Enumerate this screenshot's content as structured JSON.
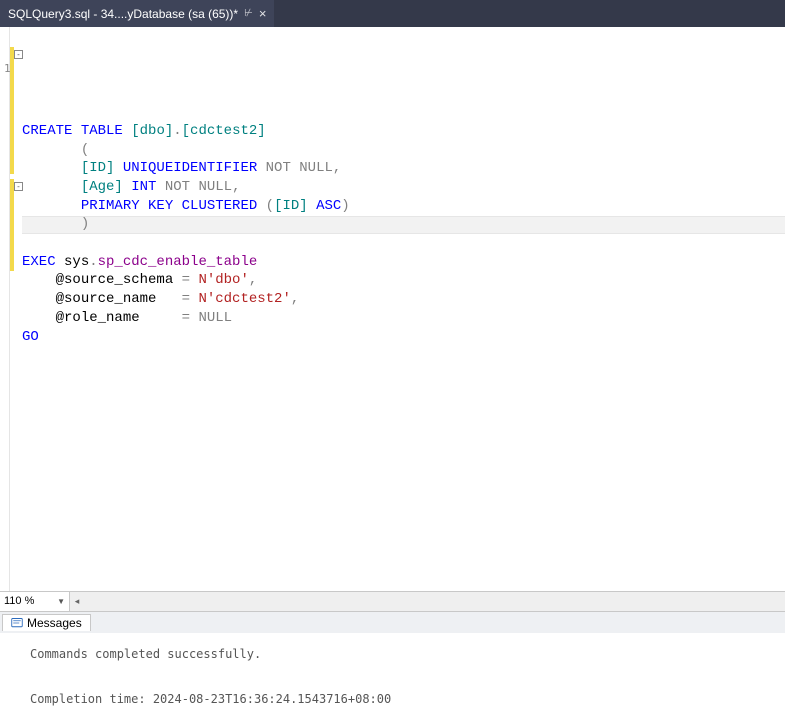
{
  "tab": {
    "title": "SQLQuery3.sql - 34....yDatabase (sa (65))*"
  },
  "gutter_marker": "1",
  "code": {
    "l1": {
      "a": "CREATE",
      "b": " TABLE ",
      "c": "[dbo]",
      "d": ".",
      "e": "[cdctest2]"
    },
    "l2": "(",
    "l3": {
      "a": "[ID]",
      "b": " UNIQUEIDENTIFIER ",
      "c": "NOT",
      "d": " NULL,"
    },
    "l4": {
      "a": "[Age]",
      "b": " INT ",
      "c": "NOT",
      "d": " NULL,"
    },
    "l5": {
      "a": "PRIMARY",
      "b": " KEY ",
      "c": "CLUSTERED ",
      "d": "(",
      "e": "[ID]",
      "f": " ASC",
      "g": ")"
    },
    "l6": ")",
    "l7": {
      "a": "EXEC",
      "b": " sys",
      "c": ".",
      "d": "sp_cdc_enable_table"
    },
    "l8": {
      "a": "@source_schema",
      "b": " =",
      "c": " N'dbo'",
      "d": ","
    },
    "l9": {
      "a": "@source_name  ",
      "b": " =",
      "c": " N'cdctest2'",
      "d": ","
    },
    "l10": {
      "a": "@role_name    ",
      "b": " =",
      "c": " NULL"
    },
    "l11": "GO"
  },
  "zoom": "110 %",
  "messages": {
    "tab": "Messages",
    "line1": "Commands completed successfully.",
    "line2": "Completion time: 2024-08-23T16:36:24.1543716+08:00"
  }
}
